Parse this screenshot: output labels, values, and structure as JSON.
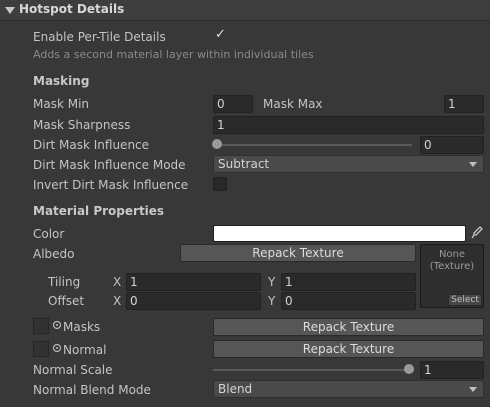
{
  "header": {
    "title": "Hotspot Details"
  },
  "per_tile": {
    "label": "Enable Per-Tile Details",
    "checked": true,
    "description": "Adds a second material layer within individual tiles"
  },
  "masking": {
    "title": "Masking",
    "mask_min_label": "Mask Min",
    "mask_min_value": "0",
    "mask_max_label": "Mask Max",
    "mask_max_value": "1",
    "sharpness_label": "Mask Sharpness",
    "sharpness_value": "1",
    "dirt_influence_label": "Dirt Mask Influence",
    "dirt_influence_value": "0",
    "dirt_mode_label": "Dirt Mask Influence Mode",
    "dirt_mode_value": "Subtract",
    "invert_label": "Invert Dirt Mask Influence",
    "invert_checked": false
  },
  "material": {
    "title": "Material Properties",
    "color_label": "Color",
    "color_value": "#ffffff",
    "albedo_label": "Albedo",
    "repack_label": "Repack Texture",
    "texture_none": "None\n(Texture)",
    "select_label": "Select",
    "tiling_label": "Tiling",
    "tiling_x": "1",
    "tiling_y": "1",
    "offset_label": "Offset",
    "offset_x": "0",
    "offset_y": "0",
    "x_label": "X",
    "y_label": "Y",
    "masks_label": "Masks",
    "masks_repack": "Repack Texture",
    "normal_label": "Normal",
    "normal_repack": "Repack Texture",
    "normal_scale_label": "Normal Scale",
    "normal_scale_value": "1",
    "normal_blend_label": "Normal Blend Mode",
    "normal_blend_value": "Blend"
  },
  "icons": {
    "foldout": "triangle-down-icon",
    "eyedropper": "eyedropper-icon",
    "object_picker": "object-picker-icon"
  }
}
